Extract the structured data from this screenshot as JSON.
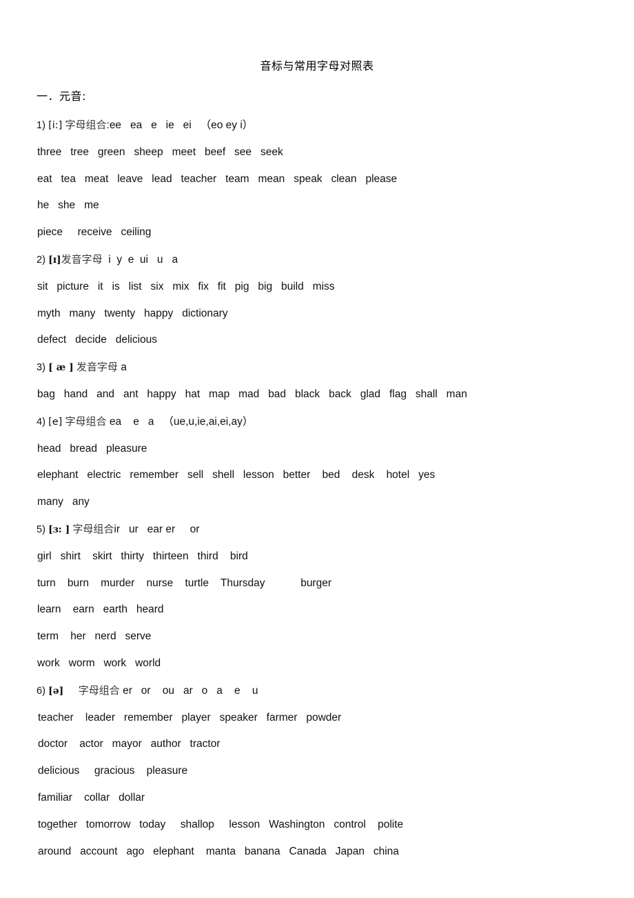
{
  "document": {
    "title": "音标与常用字母对照表",
    "section_heading": "一．元音:"
  },
  "entries": [
    {
      "index": "1)",
      "ipa": "[i:]",
      "ipa_bold": false,
      "label": "字母组合",
      "separator": ":",
      "letters": "ee   ea   e   ie   ei   （eo ey i）",
      "word_lines": [
        "three   tree   green   sheep   meet   beef   see   seek",
        "eat   tea   meat   leave   lead   teacher   team   mean   speak   clean   please",
        "he   she   me",
        "piece     receive   ceiling"
      ]
    },
    {
      "index": "2)",
      "ipa": "[ɪ]",
      "ipa_bold": true,
      "label": "发音字母",
      "separator": "",
      "letters": "  i  y  e  ui   u   a",
      "word_lines": [
        "sit   picture   it   is   list   six   mix   fix   fit   pig   big   build   miss",
        "myth   many   twenty   happy   dictionary",
        "defect   decide   delicious"
      ]
    },
    {
      "index": "3)",
      "ipa": "[ æ ]",
      "ipa_bold": true,
      "label": "发音字母",
      "separator": "",
      "letters": " a",
      "word_lines": [
        "bag   hand   and   ant   happy   hat   map   mad   bad   black   back   glad   flag   shall   man"
      ]
    },
    {
      "index": "4)",
      "ipa": "[e]",
      "ipa_bold": false,
      "label": "字母组合",
      "separator": "",
      "letters": " ea    e   a   （ue,u,ie,ai,ei,ay）",
      "word_lines": [
        "head   bread   pleasure",
        "elephant   electric   remember   sell   shell   lesson   better    bed    desk    hotel   yes",
        "many   any"
      ]
    },
    {
      "index": "5)",
      "ipa": "[ɜ: ]",
      "ipa_bold": true,
      "label": "字母组合",
      "separator": "",
      "letters": "ir   ur   ear er     or",
      "word_lines": [
        "girl   shirt    skirt   thirty   thirteen   third    bird",
        "turn    burn    murder    nurse    turtle    Thursday            burger",
        "learn    earn   earth   heard",
        "term    her   nerd   serve",
        "work   worm   work   world"
      ]
    },
    {
      "index": "6)",
      "ipa": "[ə]",
      "ipa_bold": false,
      "label": "字母组合",
      "separator": "",
      "letters": " er   or    ou   ar   o   a    e    u",
      "label_pad": "     ",
      "word_lines": [
        "teacher    leader   remember   player   speaker   farmer   powder",
        "doctor    actor   mayor   author   tractor",
        "delicious     gracious    pleasure",
        "familiar    collar   dollar",
        "together   tomorrow   today     shallop     lesson   Washington   control    polite",
        "around   account   ago   elephant    manta   banana   Canada   Japan   china"
      ]
    }
  ]
}
